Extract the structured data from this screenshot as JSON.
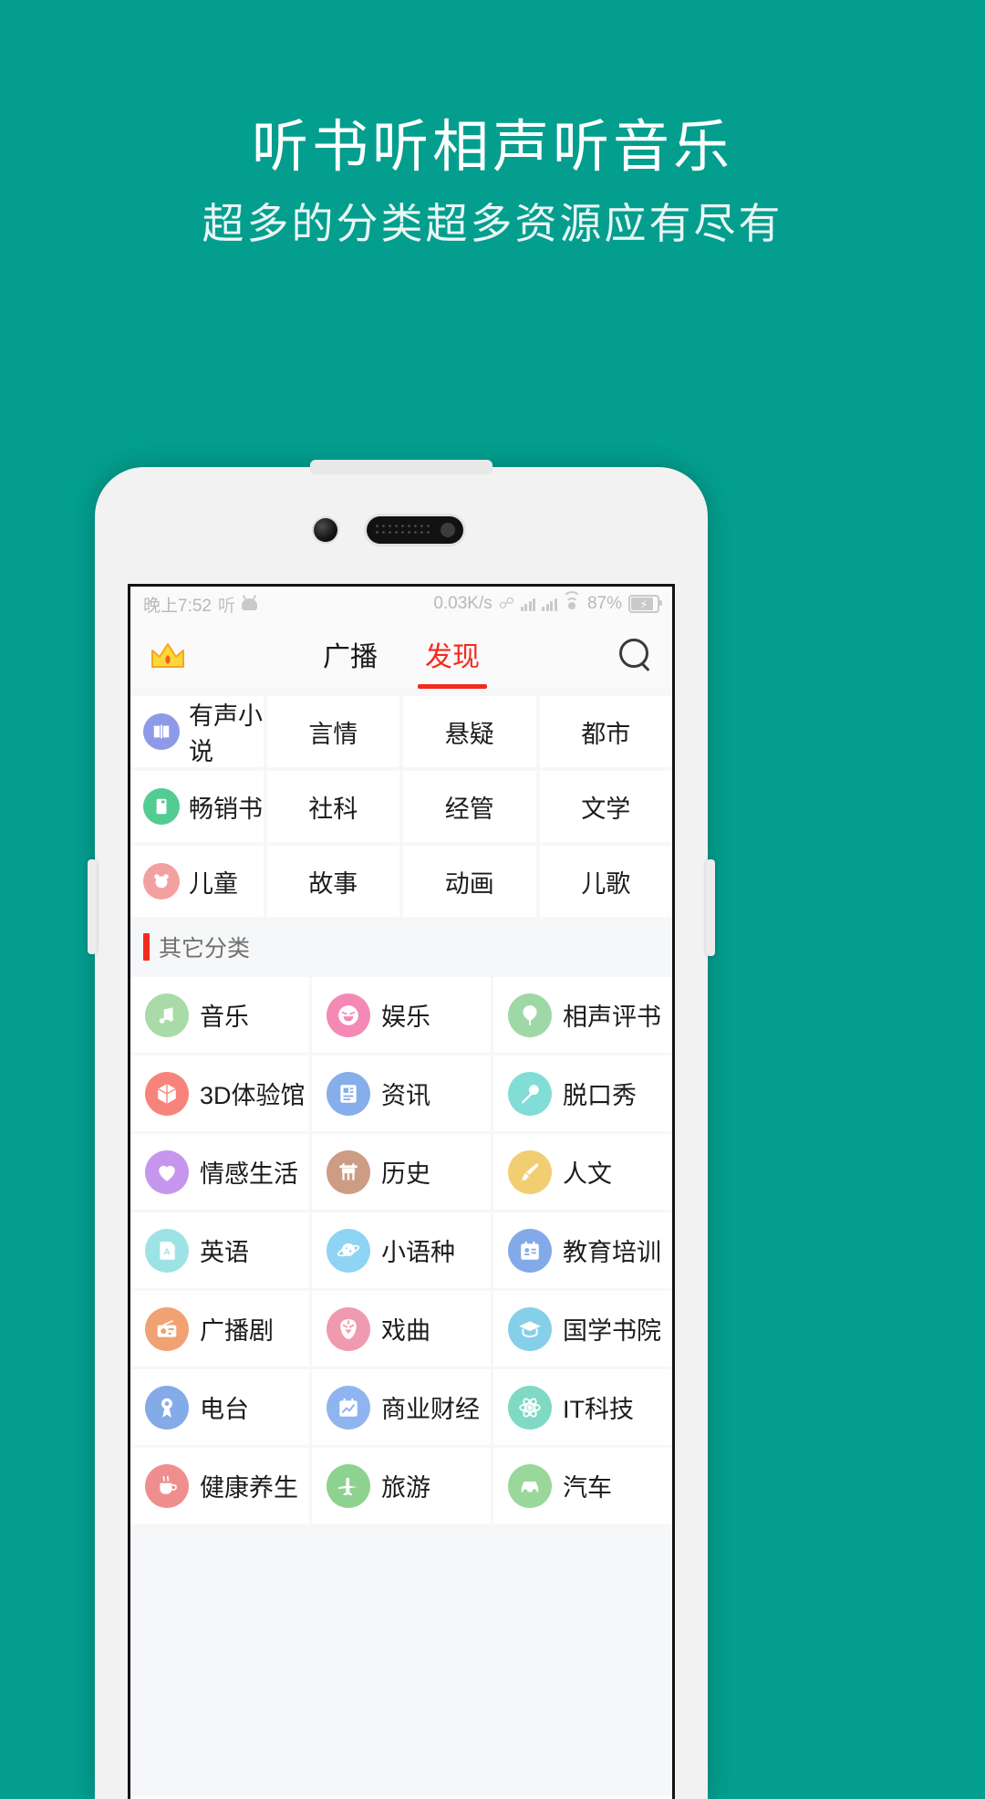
{
  "promo": {
    "title": "听书听相声听音乐",
    "subtitle": "超多的分类超多资源应有尽有",
    "bg_color": "#039e8e"
  },
  "status_bar": {
    "time": "晚上7:52",
    "app_badge": "听",
    "net_speed": "0.03K/s",
    "battery_percent": "87%",
    "icons": [
      "android-icon",
      "bluetooth-icon",
      "signal-icon",
      "signal-icon",
      "wifi-icon",
      "battery-charging-icon"
    ]
  },
  "nav": {
    "crown": "crown-icon",
    "search": "search-icon",
    "tabs": [
      {
        "label": "广播",
        "active": false
      },
      {
        "label": "发现",
        "active": true
      }
    ],
    "active_color": "#f52a1e"
  },
  "top_grid": {
    "rows": [
      {
        "icon": "open-book-icon",
        "icon_color": "#8c9ae8",
        "items": [
          "有声小说",
          "言情",
          "悬疑",
          "都市"
        ]
      },
      {
        "icon": "notebook-icon",
        "icon_color": "#52cc92",
        "items": [
          "畅销书",
          "社科",
          "经管",
          "文学"
        ]
      },
      {
        "icon": "bear-face-icon",
        "icon_color": "#f2a0a0",
        "items": [
          "儿童",
          "故事",
          "动画",
          "儿歌"
        ]
      }
    ]
  },
  "section": {
    "title": "其它分类",
    "accent": "#f52a1e"
  },
  "other_categories": [
    {
      "label": "音乐",
      "icon": "music-note-icon",
      "color": "#a9dba9"
    },
    {
      "label": "娱乐",
      "icon": "smiley-face-icon",
      "color": "#f589b6"
    },
    {
      "label": "相声评书",
      "icon": "balloon-icon",
      "color": "#9ed8a6"
    },
    {
      "label": "3D体验馆",
      "icon": "cube-icon",
      "color": "#f7847c"
    },
    {
      "label": "资讯",
      "icon": "news-doc-icon",
      "color": "#86aeea"
    },
    {
      "label": "脱口秀",
      "icon": "microphone-icon",
      "color": "#82ddd6"
    },
    {
      "label": "情感生活",
      "icon": "heart-icon",
      "color": "#c696ef"
    },
    {
      "label": "历史",
      "icon": "ding-vessel-icon",
      "color": "#cc9c85"
    },
    {
      "label": "人文",
      "icon": "paintbrush-icon",
      "color": "#f2ce72"
    },
    {
      "label": "英语",
      "icon": "letter-a-book-icon",
      "color": "#9de3e6"
    },
    {
      "label": "小语种",
      "icon": "planet-icon",
      "color": "#8fd4f2"
    },
    {
      "label": "教育培训",
      "icon": "id-card-icon",
      "color": "#84a9e8"
    },
    {
      "label": "广播剧",
      "icon": "radio-icon",
      "color": "#f0a273"
    },
    {
      "label": "戏曲",
      "icon": "opera-mask-icon",
      "color": "#ef9aae"
    },
    {
      "label": "国学书院",
      "icon": "graduation-cap-icon",
      "color": "#86cfe8"
    },
    {
      "label": "电台",
      "icon": "broadcast-badge-icon",
      "color": "#85aae8"
    },
    {
      "label": "商业财经",
      "icon": "chart-board-icon",
      "color": "#8fb4ef"
    },
    {
      "label": "IT科技",
      "icon": "atom-icon",
      "color": "#7fd9c4"
    },
    {
      "label": "健康养生",
      "icon": "teacup-icon",
      "color": "#ef8e8e"
    },
    {
      "label": "旅游",
      "icon": "airplane-icon",
      "color": "#8ed290"
    },
    {
      "label": "汽车",
      "icon": "car-icon",
      "color": "#9ad79a"
    }
  ]
}
